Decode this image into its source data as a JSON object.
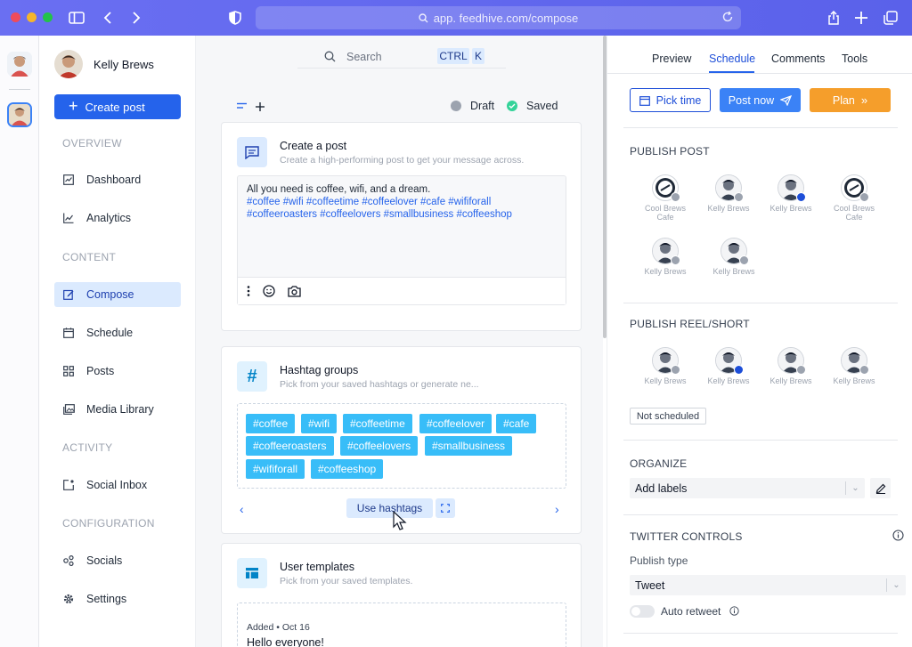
{
  "browser": {
    "url": "app. feedhive.com/compose",
    "traffic": [
      "#ef4b5b",
      "#f5b52b",
      "#23c24a"
    ]
  },
  "user": {
    "name": "Kelly Brews"
  },
  "sidebar": {
    "create_label": "Create post",
    "sections": {
      "overview": "OVERVIEW",
      "content": "CONTENT",
      "activity": "ACTIVITY",
      "configuration": "CONFIGURATION"
    },
    "items": {
      "dashboard": "Dashboard",
      "analytics": "Analytics",
      "compose": "Compose",
      "schedule": "Schedule",
      "posts": "Posts",
      "media": "Media Library",
      "inbox": "Social Inbox",
      "socials": "Socials",
      "settings": "Settings"
    }
  },
  "search": {
    "placeholder": "Search",
    "kbd1": "CTRL",
    "kbd2": "K"
  },
  "status": {
    "draft": "Draft",
    "saved": "Saved"
  },
  "create_card": {
    "title": "Create a post",
    "subtitle": "Create a high-performing post to get your message across.",
    "text": "All you need is coffee, wifi, and a dream.",
    "tags_line1": "#coffee #wifi #coffeetime #coffeelover #cafe #wififorall",
    "tags_line2": "#coffeeroasters #coffeelovers #smallbusiness #coffeeshop"
  },
  "hashtag_card": {
    "title": "Hashtag groups",
    "subtitle": "Pick from your saved hashtags or generate ne...",
    "chips": [
      "#coffee",
      "#wifi",
      "#coffeetime",
      "#coffeelover",
      "#cafe",
      "#coffeeroasters",
      "#coffeelovers",
      "#smallbusiness",
      "#wififorall",
      "#coffeeshop"
    ],
    "use_label": "Use hashtags"
  },
  "templates_card": {
    "title": "User templates",
    "subtitle": "Pick from your saved templates.",
    "added": "Added • Oct 16",
    "preview": "Hello everyone!"
  },
  "right_panel": {
    "tabs": [
      "Preview",
      "Schedule",
      "Comments",
      "Tools"
    ],
    "active_tab": "Schedule",
    "pick_time": "Pick time",
    "post_now": "Post now",
    "plan": "Plan",
    "publish_post": "PUBLISH POST",
    "post_accounts": [
      {
        "label": "Cool Brews Cafe",
        "kind": "logo"
      },
      {
        "label": "Kelly Brews",
        "kind": "face"
      },
      {
        "label": "Kelly Brews",
        "kind": "face"
      },
      {
        "label": "Cool Brews Cafe",
        "kind": "logo"
      },
      {
        "label": "Kelly Brews",
        "kind": "face"
      },
      {
        "label": "Kelly Brews",
        "kind": "face"
      }
    ],
    "publish_reel": "PUBLISH REEL/SHORT",
    "reel_accounts": [
      {
        "label": "Kelly Brews"
      },
      {
        "label": "Kelly Brews"
      },
      {
        "label": "Kelly Brews"
      },
      {
        "label": "Kelly Brews"
      }
    ],
    "not_scheduled": "Not scheduled",
    "organize": "ORGANIZE",
    "add_labels": "Add labels",
    "twitter_controls": "TWITTER CONTROLS",
    "publish_type_label": "Publish type",
    "publish_type_value": "Tweet",
    "auto_retweet": "Auto retweet"
  }
}
